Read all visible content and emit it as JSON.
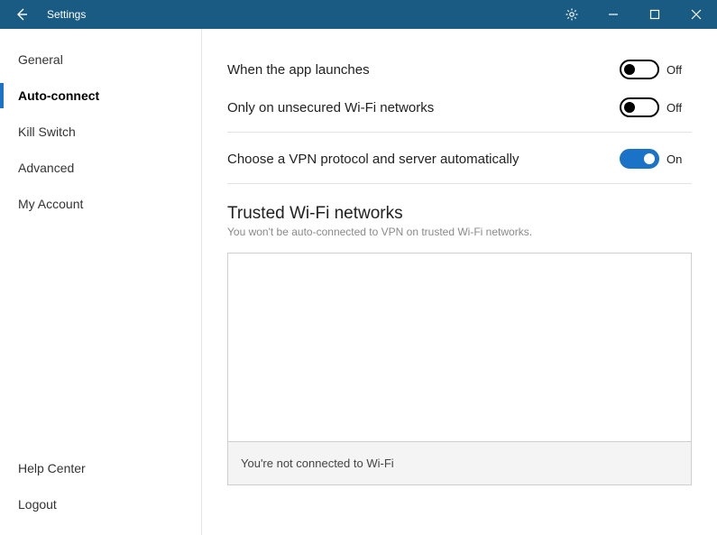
{
  "titlebar": {
    "title": "Settings"
  },
  "sidebar": {
    "items": [
      {
        "label": "General"
      },
      {
        "label": "Auto-connect"
      },
      {
        "label": "Kill Switch"
      },
      {
        "label": "Advanced"
      },
      {
        "label": "My Account"
      }
    ],
    "footer": [
      {
        "label": "Help Center"
      },
      {
        "label": "Logout"
      }
    ]
  },
  "content": {
    "toggles": [
      {
        "label": "When the app launches",
        "on": false,
        "state": "Off"
      },
      {
        "label": "Only on unsecured Wi-Fi networks",
        "on": false,
        "state": "Off"
      },
      {
        "label": "Choose a VPN protocol and server automatically",
        "on": true,
        "state": "On"
      }
    ],
    "trusted": {
      "title": "Trusted Wi-Fi networks",
      "subtitle": "You won't be auto-connected to VPN on trusted Wi-Fi networks.",
      "footer": "You're not connected to Wi-Fi"
    }
  }
}
